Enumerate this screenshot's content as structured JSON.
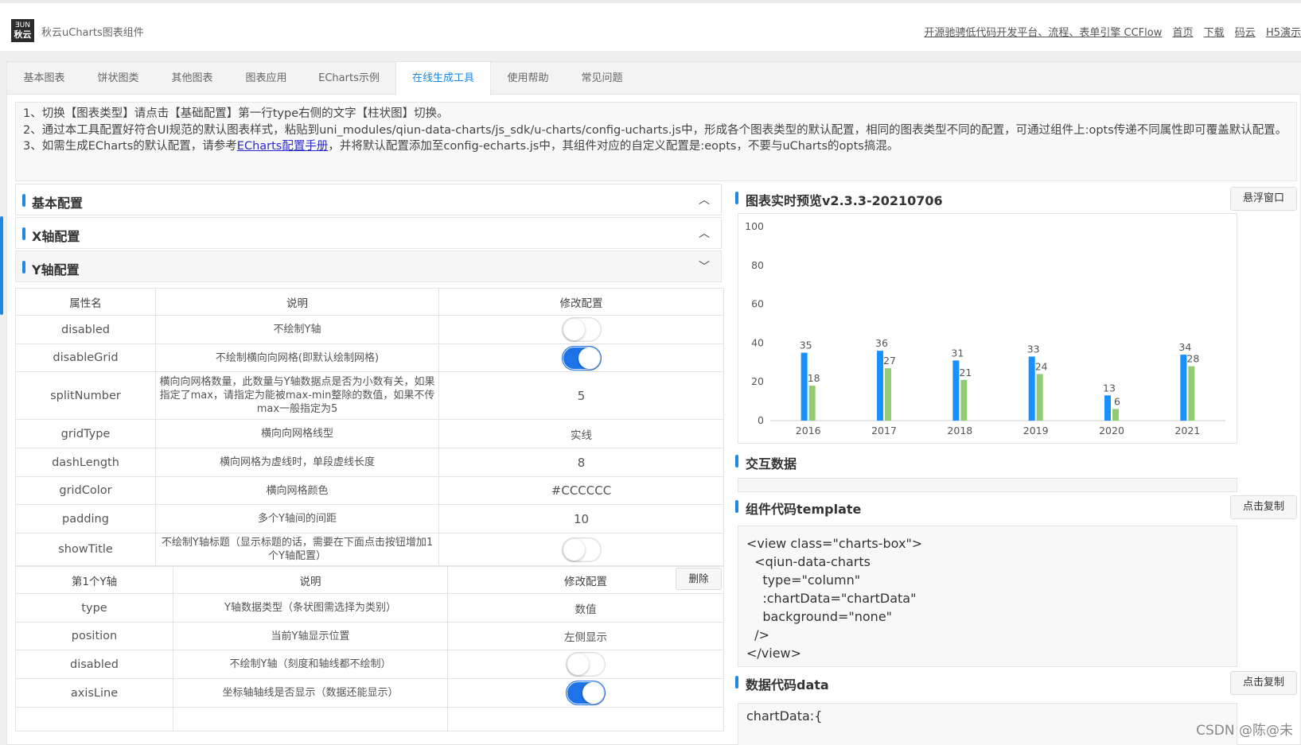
{
  "header": {
    "logo_text_top": "ƎUN",
    "logo_text_bottom": "秋云",
    "title": "秋云uCharts图表组件",
    "links": [
      "开源驰骋低代码开发平台、流程、表单引擎 CCFlow",
      "首页",
      "下载",
      "码云",
      "H5演示"
    ]
  },
  "tabs": [
    "基本图表",
    "饼状图类",
    "其他图表",
    "图表应用",
    "ECharts示例",
    "在线生成工具",
    "使用帮助",
    "常见问题"
  ],
  "active_tab": "在线生成工具",
  "notice": {
    "line1": "1、切换【图表类型】请点击【基础配置】第一行type右侧的文字【柱状图】切换。",
    "line2": "2、通过本工具配置好符合UI规范的默认图表样式，粘贴到uni_modules/qiun-data-charts/js_sdk/u-charts/config-ucharts.js中，形成各个图表类型的默认配置，相同的图表类型不同的配置，可通过组件上:opts传递不同属性即可覆盖默认配置。",
    "line3_prefix": "3、如需生成ECharts的默认配置，请参考",
    "line3_link": "ECharts配置手册",
    "line3_suffix": "，并将默认配置添加至config-echarts.js中，其组件对应的自定义配置是:eopts，不要与uCharts的opts搞混。"
  },
  "sections": {
    "basic": "基本配置",
    "xaxis": "X轴配置",
    "yaxis": "Y轴配置"
  },
  "yaxis_table": {
    "headers": [
      "属性名",
      "说明",
      "修改配置"
    ],
    "rows": [
      {
        "name": "disabled",
        "desc": "不绘制Y轴",
        "toggle": false
      },
      {
        "name": "disableGrid",
        "desc": "不绘制横向向网格(即默认绘制网格)",
        "toggle": true
      },
      {
        "name": "splitNumber",
        "desc": "横向向网格数量，此数量与Y轴数据点是否为小数有关，如果指定了max，请指定为能被max-min整除的数值，如果不传max一般指定为5",
        "value": "5"
      },
      {
        "name": "gridType",
        "desc": "横向向网格线型",
        "value": "实线"
      },
      {
        "name": "dashLength",
        "desc": "横向网格为虚线时，单段虚线长度",
        "value": "8"
      },
      {
        "name": "gridColor",
        "desc": "横向网格颜色",
        "value": "#CCCCCC"
      },
      {
        "name": "padding",
        "desc": "多个Y轴间的间距",
        "value": "10"
      },
      {
        "name": "showTitle",
        "desc": "不绘制Y轴标题（显示标题的话，需要在下面点击按钮增加1个Y轴配置）",
        "toggle": false
      }
    ]
  },
  "y1_table": {
    "headers": [
      "第1个Y轴",
      "说明",
      "修改配置"
    ],
    "delete_label": "删除",
    "rows": [
      {
        "name": "type",
        "desc": "Y轴数据类型（条状图需选择为类别）",
        "value": "数值"
      },
      {
        "name": "position",
        "desc": "当前Y轴显示位置",
        "value": "左侧显示"
      },
      {
        "name": "disabled",
        "desc": "不绘制Y轴（刻度和轴线都不绘制）",
        "toggle": false
      },
      {
        "name": "axisLine",
        "desc": "坐标轴轴线是否显示（数据还能显示）",
        "toggle": true
      }
    ]
  },
  "right": {
    "preview_title": "图表实时预览v2.3.3-20210706",
    "float_btn": "悬浮窗口",
    "interact_title": "交互数据",
    "template_title": "组件代码template",
    "copy_btn": "点击复制",
    "template_code": "<view class=\"charts-box\">\n  <qiun-data-charts\n    type=\"column\"\n    :chartData=\"chartData\"\n    background=\"none\"\n  />\n</view>",
    "data_title": "数据代码data",
    "data_copy_btn": "点击复制",
    "data_code": "chartData:{"
  },
  "colors": {
    "accent": "#1e88e5",
    "series1": "#1890ff",
    "series2": "#91cb74"
  },
  "chart_data": {
    "type": "bar",
    "categories": [
      "2016",
      "2017",
      "2018",
      "2019",
      "2020",
      "2021"
    ],
    "series": [
      {
        "values": [
          35,
          36,
          31,
          33,
          13,
          34
        ]
      },
      {
        "values": [
          18,
          27,
          21,
          24,
          6,
          28
        ]
      }
    ],
    "yticks": [
      0,
      20,
      40,
      60,
      80,
      100
    ],
    "ylim": [
      0,
      100
    ],
    "grid": false
  },
  "watermark": "CSDN @陈@未"
}
